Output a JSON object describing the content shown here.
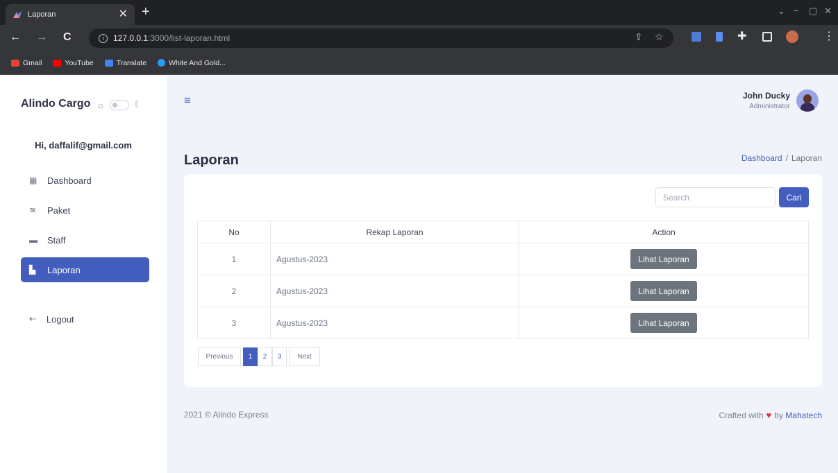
{
  "browser": {
    "tab_title": "Laporan",
    "url_host": "127.0.0.1",
    "url_path": ":3000/list-laporan.html",
    "bookmarks": [
      {
        "label": "Gmail",
        "color": "#ea4335"
      },
      {
        "label": "YouTube",
        "color": "#ff0000"
      },
      {
        "label": "Translate",
        "color": "#4285f4"
      },
      {
        "label": "White And Gold...",
        "color": "#2a9df4"
      }
    ]
  },
  "sidebar": {
    "brand": "Alindo Cargo",
    "greeting": "Hi, daffalif@gmail.com",
    "items": [
      {
        "label": "Dashboard",
        "icon": "grid-icon"
      },
      {
        "label": "Paket",
        "icon": "stack-icon"
      },
      {
        "label": "Staff",
        "icon": "briefcase-icon"
      },
      {
        "label": "Laporan",
        "icon": "layout-icon",
        "active": true
      }
    ],
    "logout": "Logout"
  },
  "header": {
    "user_name": "John Ducky",
    "user_role": "Administrator"
  },
  "page": {
    "title": "Laporan",
    "breadcrumb": {
      "home": "Dashboard",
      "separator": "/",
      "current": "Laporan"
    }
  },
  "search": {
    "placeholder": "Search",
    "button": "Cari"
  },
  "table": {
    "headers": [
      "No",
      "Rekap Laporan",
      "Action"
    ],
    "rows": [
      {
        "no": "1",
        "rekap": "Agustus-2023",
        "action": "Lihat Laporan"
      },
      {
        "no": "2",
        "rekap": "Agustus-2023",
        "action": "Lihat Laporan"
      },
      {
        "no": "3",
        "rekap": "Agustus-2023",
        "action": "Lihat Laporan"
      }
    ]
  },
  "pagination": {
    "previous": "Previous",
    "pages": [
      "1",
      "2",
      "3"
    ],
    "next": "Next",
    "current": "1"
  },
  "footer": {
    "left": "2021 © Alindo Express",
    "crafted": "Crafted with",
    "by": "by",
    "author": "Mahatech"
  },
  "colors": {
    "accent": "#435ebe",
    "secondary_button": "#6c757d",
    "heart": "#dc3545"
  }
}
